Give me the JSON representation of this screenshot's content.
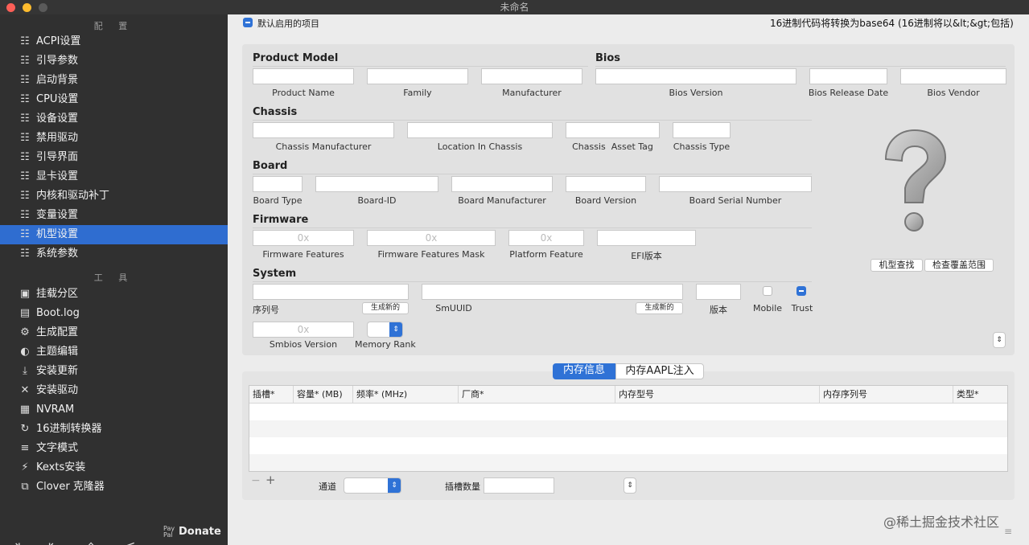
{
  "window": {
    "title": "未命名"
  },
  "sidebar": {
    "config_header": "配 置",
    "config_items": [
      {
        "label": "ACPI设置",
        "icon": "list-icon"
      },
      {
        "label": "引导参数",
        "icon": "list-icon"
      },
      {
        "label": "启动背景",
        "icon": "list-icon"
      },
      {
        "label": "CPU设置",
        "icon": "list-icon"
      },
      {
        "label": "设备设置",
        "icon": "list-icon"
      },
      {
        "label": "禁用驱动",
        "icon": "list-icon"
      },
      {
        "label": "引导界面",
        "icon": "list-icon"
      },
      {
        "label": "显卡设置",
        "icon": "list-icon"
      },
      {
        "label": "内核和驱动补丁",
        "icon": "list-icon"
      },
      {
        "label": "变量设置",
        "icon": "list-icon"
      },
      {
        "label": "机型设置",
        "icon": "list-icon",
        "selected": true
      },
      {
        "label": "系统参数",
        "icon": "list-icon"
      }
    ],
    "tools_header": "工 具",
    "tool_items": [
      {
        "label": "挂载分区",
        "icon": "disk-icon"
      },
      {
        "label": "Boot.log",
        "icon": "document-icon"
      },
      {
        "label": "生成配置",
        "icon": "gears-icon"
      },
      {
        "label": "主题编辑",
        "icon": "palette-icon"
      },
      {
        "label": "安装更新",
        "icon": "download-icon"
      },
      {
        "label": "安装驱动",
        "icon": "tools-icon"
      },
      {
        "label": "NVRAM",
        "icon": "chip-icon"
      },
      {
        "label": "16进制转换器",
        "icon": "refresh-icon"
      },
      {
        "label": "文字模式",
        "icon": "text-icon"
      },
      {
        "label": "Kexts安装",
        "icon": "plug-icon"
      },
      {
        "label": "Clover 克隆器",
        "icon": "copy-icon"
      }
    ],
    "bottom": {
      "donate_prefix": "Pay Pal",
      "donate_label": "Donate"
    }
  },
  "top": {
    "default_enabled": "默认启用的项目",
    "hex_note": "16进制代码将转换为base64 (16进制将以&lt;&gt;包括)"
  },
  "product": {
    "product_model_header": "Product Model",
    "bios_header": "Bios",
    "product_name": "Product Name",
    "family": "Family",
    "manufacturer": "Manufacturer",
    "bios_version": "Bios Version",
    "bios_release_date": "Bios Release Date",
    "bios_vendor": "Bios Vendor",
    "chassis_header": "Chassis",
    "chassis_manufacturer": "Chassis Manufacturer",
    "location_in_chassis": "Location In Chassis",
    "chassis_asset_tag": "Chassis  Asset Tag",
    "chassis_type": "Chassis Type",
    "board_header": "Board",
    "board_type": "Board Type",
    "board_id": "Board-ID",
    "board_manufacturer": "Board Manufacturer",
    "board_version": "Board Version",
    "board_serial": "Board Serial Number",
    "firmware_header": "Firmware",
    "hex_placeholder": "0x",
    "firmware_features": "Firmware Features",
    "firmware_features_mask": "Firmware Features Mask",
    "platform_feature": "Platform Feature",
    "efi_version": "EFI版本",
    "system_header": "System",
    "serial_number": "序列号",
    "generate_new": "生成新的",
    "smuuid": "SmUUID",
    "version": "版本",
    "mobile": "Mobile",
    "trust": "Trust",
    "smbios_version": "Smbios Version",
    "memory_rank": "Memory Rank",
    "model_lookup": "机型查找",
    "check_coverage": "检查覆盖范围"
  },
  "memory": {
    "tabs": [
      {
        "label": "内存信息",
        "active": true
      },
      {
        "label": "内存AAPL注入",
        "active": false
      }
    ],
    "columns": [
      "插槽*",
      "容量* (MB)",
      "频率* (MHz)",
      "厂商*",
      "内存型号",
      "内存序列号",
      "类型*"
    ],
    "channel_label": "通道",
    "slot_count_label": "插槽数量"
  },
  "watermark": "@稀土掘金技术社区",
  "colors": {
    "accent": "#2f72d6",
    "sidebar_bg": "#303030",
    "selected": "#2f6dd0"
  }
}
